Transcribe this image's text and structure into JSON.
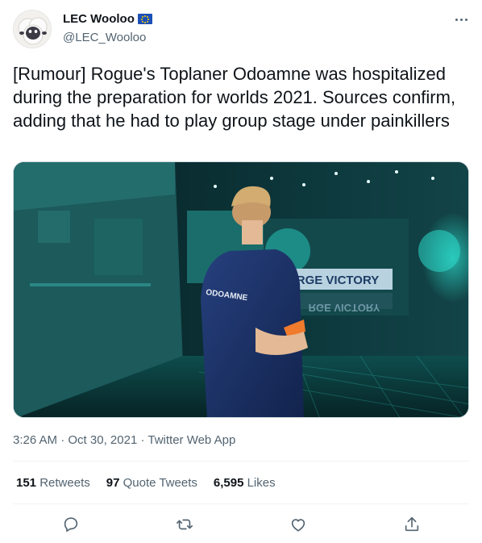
{
  "author": {
    "name": "LEC Wooloo",
    "handle": "@LEC_Wooloo",
    "flag_icon": "eu-flag-icon",
    "avatar_icon": "wooloo-avatar"
  },
  "tweet": {
    "text": "[Rumour] Rogue's Toplaner Odoamne was hospitalized during the preparation for worlds 2021. Sources confirm, adding that he had to play group stage under painkillers"
  },
  "media": {
    "jersey_text": "ODOAMNE",
    "sign_text": "RGE VICTORY",
    "sign_reflection": "RGE VICTORY"
  },
  "meta": {
    "time": "3:26 AM",
    "separator1": " · ",
    "date": "Oct 30, 2021",
    "separator2": " · ",
    "source": "Twitter Web App"
  },
  "stats": {
    "retweets_count": "151",
    "retweets_label": "Retweets",
    "quotes_count": "97",
    "quotes_label": "Quote Tweets",
    "likes_count": "6,595",
    "likes_label": "Likes"
  },
  "actions": {
    "reply_icon": "reply-icon",
    "retweet_icon": "retweet-icon",
    "like_icon": "heart-icon",
    "share_icon": "share-icon"
  },
  "colors": {
    "text": "#0f1419",
    "secondary": "#536471",
    "border": "#eff3f4",
    "teal_accent": "#1fd1c1"
  }
}
